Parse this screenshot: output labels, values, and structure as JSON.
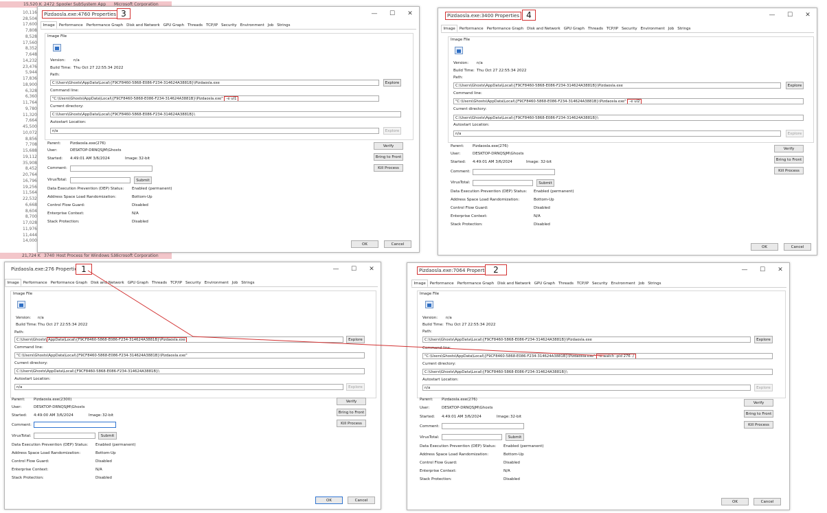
{
  "background": {
    "numbers": [
      "15,520 K",
      "10,116",
      "28,504",
      "17,600",
      "7,808",
      "8,528",
      "17,560",
      "8,352",
      "7,648",
      "14,232",
      "23,476",
      "5,944",
      "17,836",
      "18,900",
      "6,328",
      "6,360",
      "11,764",
      "9,780",
      "11,320",
      "7,664",
      "45,500",
      "10,072",
      "8,856",
      "7,708",
      "15,688",
      "19,112",
      "35,908",
      "8,452",
      "20,764",
      "16,796",
      "19,256",
      "11,564",
      "22,532",
      "6,668",
      "8,604",
      "8,700",
      "17,028",
      "11,976",
      "11,444",
      "14,000"
    ],
    "row_top": {
      "pid": "2472",
      "name": "Spooler SubSystem App",
      "company": "Microsoft Corporation"
    },
    "row_bottom": {
      "mem": "21,724 K",
      "pid": "3740",
      "name": "Host Process for Windows S...",
      "company": "Microsoft Corporation"
    }
  },
  "labels": {
    "tabs": [
      "Image",
      "Performance",
      "Performance Graph",
      "Disk and Network",
      "GPU Graph",
      "Threads",
      "TCP/IP",
      "Security",
      "Environment",
      "Job",
      "Strings"
    ],
    "image_file": "Image File",
    "version": "Version:",
    "build_time": "Build Time:",
    "path": "Path:",
    "command_line": "Command line:",
    "current_directory": "Current directory:",
    "autostart": "Autostart Location:",
    "explore": "Explore",
    "parent": "Parent:",
    "user": "User:",
    "started": "Started:",
    "image": "Image:",
    "comment": "Comment:",
    "virustotal": "VirusTotal:",
    "submit": "Submit",
    "verify": "Verify",
    "bring_to_front": "Bring to Front",
    "kill_process": "Kill Process",
    "dep": "Data Execution Prevention (DEP) Status:",
    "aslr": "Address Space Load Randomization:",
    "cfg": "Control Flow Guard:",
    "enterprise": "Enterprise Context:",
    "stack": "Stack Protection:",
    "ok": "OK",
    "cancel": "Cancel",
    "minimize": "—",
    "maximize": "☐",
    "close": "✕"
  },
  "windows": [
    {
      "marker": "3",
      "title": "Pizdaosla.exe:4760 Properties",
      "version": "n/a",
      "build_time": "Thu Oct 27 22:55:34 2022",
      "path": "C:\\Users\\Ghosts\\AppData\\Local\\{F9CF8460-5868-E086-F234-314624A3881B}\\Pizdaosla.exe",
      "command_line": "\"C:\\Users\\Ghosts\\AppData\\Local\\{F9CF8460-5868-E086-F234-314624A3881B}\\Pizdaosla.exe\"",
      "cmd_arg": "-e ul1",
      "current_directory": "C:\\Users\\Ghosts\\AppData\\Local\\{F9CF8460-5868-E086-F234-314624A3881B}\\",
      "autostart": "n/a",
      "parent": "Pizdaosla.exe(276)",
      "user": "DESKTOP-DRNQSJM\\Ghosts",
      "started": "4:49:01 AM  3/6/2024",
      "image_bits": "32-bit",
      "dep": "Enabled (permanent)",
      "aslr": "Bottom-Up",
      "cfg": "Disabled",
      "enterprise": "N/A",
      "stack": "Disabled"
    },
    {
      "marker": "4",
      "title": "Pizdaosla.exe:3400 Properties",
      "version": "n/a",
      "build_time": "Thu Oct 27 22:55:34 2022",
      "path": "C:\\Users\\Ghosts\\AppData\\Local\\{F9CF8460-5868-E086-F234-314624A3881B}\\Pizdaosla.exe",
      "command_line": "\"C:\\Users\\Ghosts\\AppData\\Local\\{F9CF8460-5868-E086-F234-314624A3881B}\\Pizdaosla.exe\"",
      "cmd_arg": "-e ul2",
      "current_directory": "C:\\Users\\Ghosts\\AppData\\Local\\{F9CF8460-5868-E086-F234-314624A3881B}\\",
      "autostart": "n/a",
      "parent": "Pizdaosla.exe(276)",
      "user": "DESKTOP-DRNQSJM\\Ghosts",
      "started": "4:49:01 AM  3/6/2024",
      "image_bits": "32-bit",
      "dep": "Enabled (permanent)",
      "aslr": "Bottom-Up",
      "cfg": "Disabled",
      "enterprise": "N/A",
      "stack": "Disabled"
    },
    {
      "marker": "1",
      "title": "Pizdaosla.exe:276 Properties",
      "version": "n/a",
      "build_time": "Thu Oct 27 22:55:34 2022",
      "path_prefix": "C:\\Users\\Ghosts\\",
      "path": "AppData\\Local\\{F9CF8460-5868-E086-F234-314624A3881B}\\Pizdaosla.exe",
      "command_line": "\"C:\\Users\\Ghosts\\AppData\\Local\\{F9CF8460-5868-E086-F234-314624A3881B}\\Pizdaosla.exe\"",
      "current_directory": "C:\\Users\\Ghosts\\AppData\\Local\\{F9CF8460-5868-E086-F234-314624A3881B}\\",
      "autostart": "n/a",
      "parent": "Pizdaosla.exe(2300)",
      "user": "DESKTOP-DRNQSJM\\Ghosts",
      "started": "4:49:00 AM  3/6/2024",
      "image_bits": "32-bit",
      "dep": "Enabled (permanent)",
      "aslr": "Bottom-Up",
      "cfg": "Disabled",
      "enterprise": "N/A",
      "stack": "Disabled"
    },
    {
      "marker": "2",
      "title": "Pizdaosla.exe:7064 Properties",
      "version": "n/a",
      "build_time": "Thu Oct 27 22:55:34 2022",
      "path": "C:\\Users\\Ghosts\\AppData\\Local\\{F9CF8460-5868-E086-F234-314624A3881B}\\Pizdaosla.exe",
      "command_line": "\"C:\\Users\\Ghosts\\AppData\\Local\\{F9CF8460-5868-E086-F234-314624A3881B}\\Pizdaosla.exe\"",
      "cmd_arg": "-e watch -pid 276 -/",
      "current_directory": "C:\\Users\\Ghosts\\AppData\\Local\\{F9CF8460-5868-E086-F234-314624A3881B}\\",
      "autostart": "n/a",
      "parent": "Pizdaosla.exe(276)",
      "user": "DESKTOP-DRNQSJM\\Ghosts",
      "started": "4:49:01 AM  3/6/2024",
      "image_bits": "32-bit",
      "dep": "Enabled (permanent)",
      "aslr": "Bottom-Up",
      "cfg": "Disabled",
      "enterprise": "N/A",
      "stack": "Disabled"
    }
  ]
}
